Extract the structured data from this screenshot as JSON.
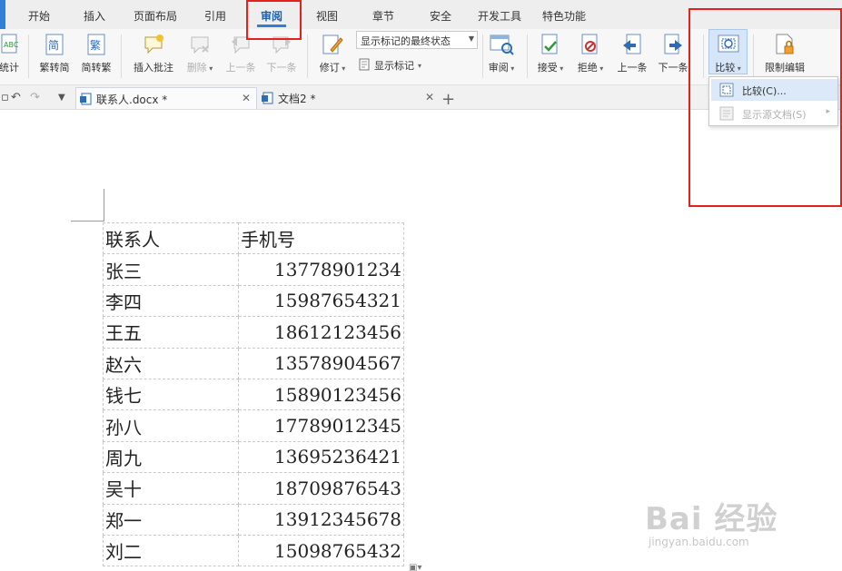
{
  "menu": {
    "tabs": [
      {
        "label": "开始"
      },
      {
        "label": "插入"
      },
      {
        "label": "页面布局"
      },
      {
        "label": "引用"
      },
      {
        "label": "审阅"
      },
      {
        "label": "视图"
      },
      {
        "label": "章节"
      },
      {
        "label": "安全"
      },
      {
        "label": "开发工具"
      },
      {
        "label": "特色功能"
      }
    ],
    "active": "审阅"
  },
  "ribbon": {
    "word_count": "统计",
    "trad_to_simp": "繁转简",
    "simp_to_trad": "简转繁",
    "insert_comment": "插入批注",
    "delete": "删除",
    "prev_comment": "上一条",
    "next_comment": "下一条",
    "revise": "修订",
    "markup_mode": "显示标记的最终状态",
    "show_markup": "显示标记",
    "review": "审阅",
    "accept": "接受",
    "reject": "拒绝",
    "prev_change": "上一条",
    "next_change": "下一条",
    "compare": "比较",
    "restrict_edit": "限制编辑"
  },
  "compare_menu": {
    "items": [
      {
        "label": "比较(C)..."
      },
      {
        "label": "显示源文档(S)"
      }
    ]
  },
  "doc_tabs": [
    {
      "label": "联系人.docx *"
    },
    {
      "label": "文档2 *"
    }
  ],
  "table": {
    "headers": [
      "联系人",
      "手机号"
    ],
    "rows": [
      [
        "张三",
        "13778901234"
      ],
      [
        "李四",
        "15987654321"
      ],
      [
        "王五",
        "18612123456"
      ],
      [
        "赵六",
        "13578904567"
      ],
      [
        "钱七",
        "15890123456"
      ],
      [
        "孙八",
        "17789012345"
      ],
      [
        "周九",
        "13695236421"
      ],
      [
        "吴十",
        "18709876543"
      ],
      [
        "郑一",
        "13912345678"
      ],
      [
        "刘二",
        "15098765432"
      ]
    ]
  },
  "watermark": {
    "main": "Bai 经验",
    "sub": "jingyan.baidu.com"
  },
  "colors": {
    "accent": "#2f7fd6",
    "highlight_box": "#e3221d",
    "menu_hover": "#dbe9f8"
  }
}
